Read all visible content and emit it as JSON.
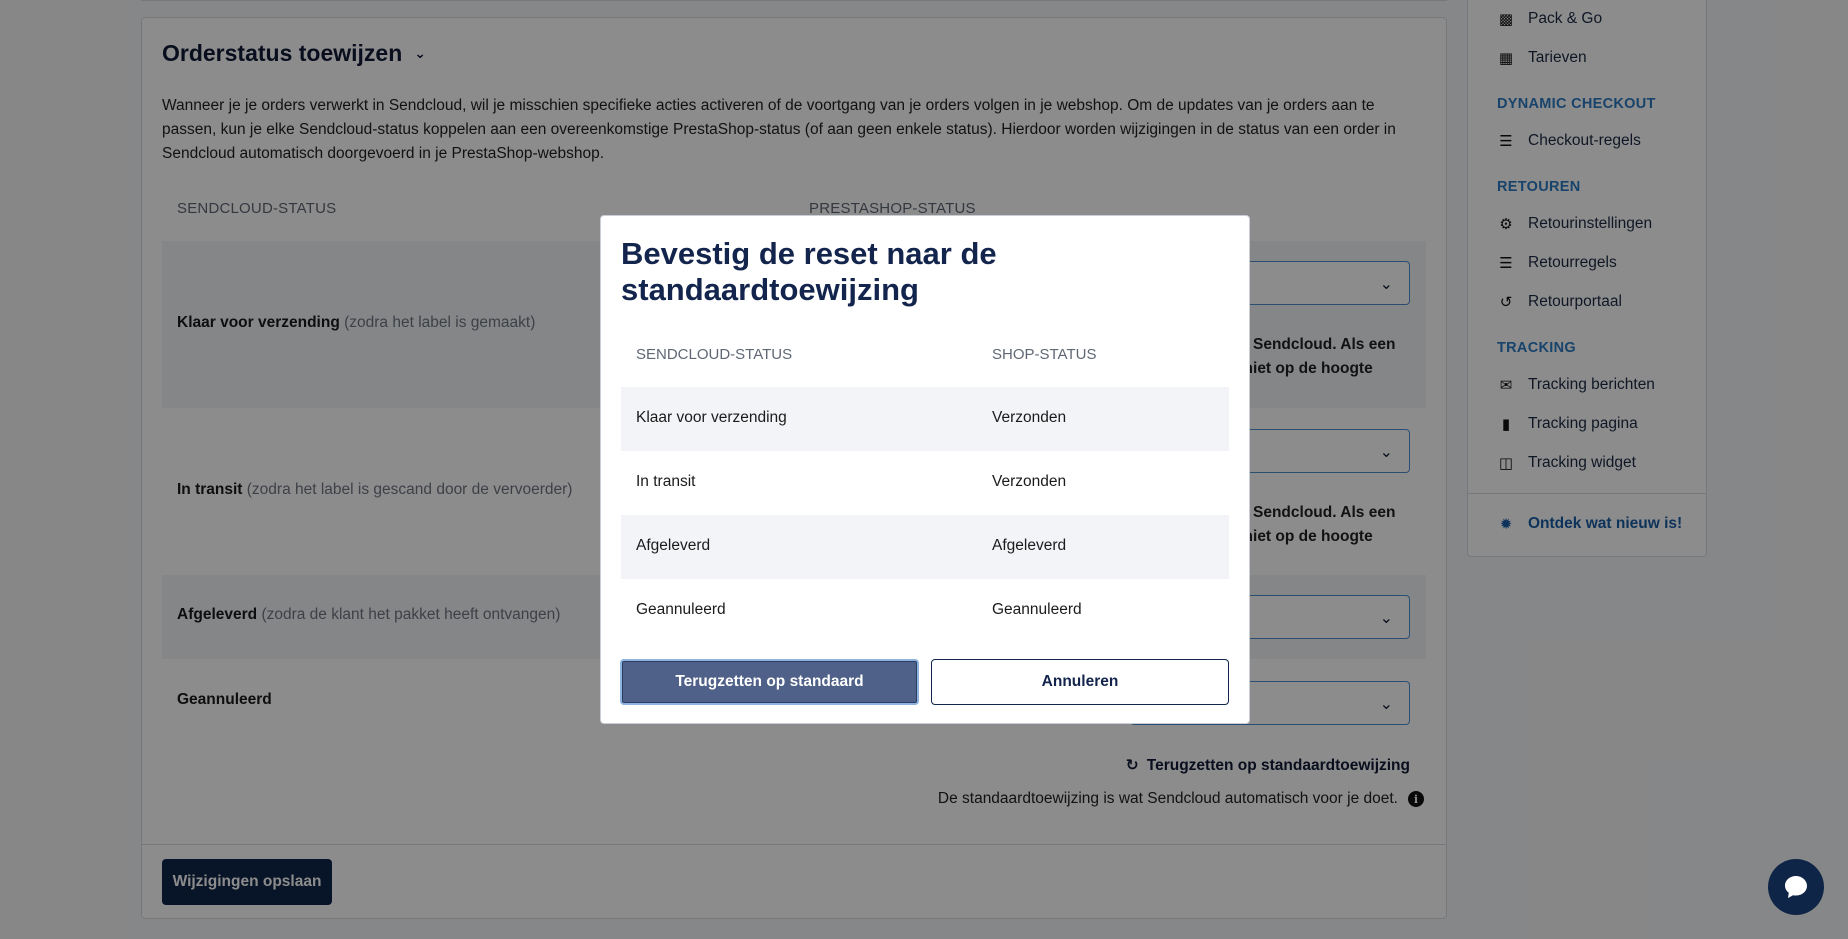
{
  "section": {
    "title": "Orderstatus toewijzen",
    "description": "Wanneer je je orders verwerkt in Sendcloud, wil je misschien specifieke acties activeren of de voortgang van je orders volgen in je webshop. Om de updates van je orders aan te passen, kun je elke Sendcloud-status koppelen aan een overeenkomstige PrestaShop-status (of aan geen enkele status). Hierdoor worden wijzigingen in de status van een order in Sendcloud automatisch doorgevoerd in je PrestaShop-webshop.",
    "col_sendcloud": "SENDCLOUD-STATUS",
    "col_prestashop": "PRESTASHOP-STATUS",
    "rows": [
      {
        "label": "Klaar voor verzending",
        "hint": "(zodra het label is gemaakt)",
        "warn": "s in Sendcloud. Als een ijk niet op de hoogte"
      },
      {
        "label": "In transit",
        "hint": "(zodra het label is gescand door de vervoerder)",
        "warn": "s in Sendcloud. Als een ijk niet op de hoogte"
      },
      {
        "label": "Afgeleverd",
        "hint": "(zodra de klant het pakket heeft ontvangen)",
        "warn": ""
      },
      {
        "label": "Geannuleerd",
        "hint": "",
        "warn": ""
      }
    ],
    "reset_link": "Terugzetten op standaardtoewijzing",
    "reset_note": "De standaardtoewijzing is wat Sendcloud automatisch voor je doet.",
    "save_button": "Wijzigingen opslaan"
  },
  "sidebar": {
    "items_top": [
      {
        "label": "Pack & Go",
        "icon": "boxes-icon"
      },
      {
        "label": "Tarieven",
        "icon": "calculator-icon"
      }
    ],
    "group_checkout": "DYNAMIC CHECKOUT",
    "checkout_items": [
      {
        "label": "Checkout-regels",
        "icon": "checklist-icon"
      }
    ],
    "group_returns": "RETOUREN",
    "returns_items": [
      {
        "label": "Retourinstellingen",
        "icon": "gear-icon"
      },
      {
        "label": "Retourregels",
        "icon": "checklist-icon"
      },
      {
        "label": "Retourportaal",
        "icon": "undo-icon"
      }
    ],
    "group_tracking": "TRACKING",
    "tracking_items": [
      {
        "label": "Tracking berichten",
        "icon": "envelope-icon"
      },
      {
        "label": "Tracking pagina",
        "icon": "file-icon"
      },
      {
        "label": "Tracking widget",
        "icon": "monitor-icon"
      }
    ],
    "whats_new": "Ontdek wat nieuw is!"
  },
  "modal": {
    "title": "Bevestig de reset naar de standaardtoewijzing",
    "col_sendcloud": "SENDCLOUD-STATUS",
    "col_shop": "SHOP-STATUS",
    "rows": [
      {
        "sendcloud": "Klaar voor verzending",
        "shop": "Verzonden"
      },
      {
        "sendcloud": "In transit",
        "shop": "Verzonden"
      },
      {
        "sendcloud": "Afgeleverd",
        "shop": "Afgeleverd"
      },
      {
        "sendcloud": "Geannuleerd",
        "shop": "Geannuleerd"
      }
    ],
    "confirm_button": "Terugzetten op standaard",
    "cancel_button": "Annuleren"
  },
  "colors": {
    "navy": "#0f2547",
    "accent_blue": "#2d7bc4",
    "overlay": "rgba(0,0,0,0.45)"
  }
}
